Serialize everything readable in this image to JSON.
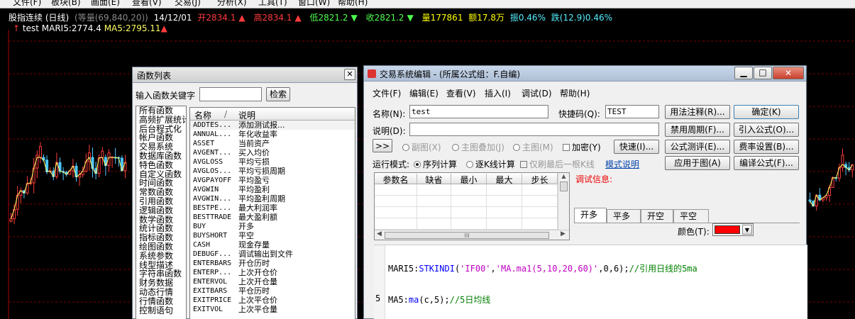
{
  "menubar": [
    "文件(F)",
    "板块(B)",
    "画面(E)",
    "查看(V)",
    "交易(J)",
    "分析(X)",
    "工具(T)",
    "窗口(W)",
    "帮助(H)"
  ],
  "chart": {
    "title": "股指连续 (日线)",
    "mode": "(等量(69,840,20))",
    "date": "14/12/01",
    "open": "开2834.1",
    "high": "高2834.1",
    "low": "低2821.2",
    "close": "收2821.2",
    "volume": "量177861",
    "amount": "额17.8万",
    "amplitude": "振0.46%",
    "change": "跌(12.9)0.46%",
    "indicator_name": "test",
    "mari5": "MARI5:2774.4",
    "ma5": "MA5:2795.11",
    "colors": {
      "up": "#ff3b3b",
      "down": "#4dc8ff",
      "ma": "#ffff66",
      "grid": "#7a0000"
    }
  },
  "function_list": {
    "title": "函数列表",
    "keyword_label": "输入函数关键字",
    "keyword_value": "",
    "search_button": "检索",
    "categories": [
      "所有函数",
      "高频扩展统计",
      "后台程式化",
      "帐户函数",
      "交易系统",
      "数据库函数",
      "特色函数",
      "自定义函数",
      "时间函数",
      "常数函数",
      "引用函数",
      "逻辑函数",
      "数学函数",
      "统计函数",
      "指标函数",
      "绘图函数",
      "系统参数",
      "线型描述",
      "字符串函数",
      "财务数据",
      "动态行情",
      "行情函数",
      "控制语句"
    ],
    "col_name": "名称",
    "col_desc": "说明",
    "rows": [
      {
        "name": "ADDTES...",
        "desc": "添加测试报..."
      },
      {
        "name": "ANNUAL...",
        "desc": "年化收益率"
      },
      {
        "name": "ASSET",
        "desc": "当前资产"
      },
      {
        "name": "AVGENT...",
        "desc": "买入均价"
      },
      {
        "name": "AVGLOSS",
        "desc": "平均亏损"
      },
      {
        "name": "AVGLOS...",
        "desc": "平均亏损周期"
      },
      {
        "name": "AVGPAYOFF",
        "desc": "平均盈亏"
      },
      {
        "name": "AVGWIN",
        "desc": "平均盈利"
      },
      {
        "name": "AVGWIN...",
        "desc": "平均盈利周期"
      },
      {
        "name": "BESTPE...",
        "desc": "最大利润率"
      },
      {
        "name": "BESTTRADE",
        "desc": "最大盈利额"
      },
      {
        "name": "BUY",
        "desc": "开多"
      },
      {
        "name": "BUYSHORT",
        "desc": "平空"
      },
      {
        "name": "CASH",
        "desc": "现金存量"
      },
      {
        "name": "DEBUGF...",
        "desc": "调试输出到文件"
      },
      {
        "name": "ENTERBARS",
        "desc": "开仓历时"
      },
      {
        "name": "ENTERP...",
        "desc": "上次开仓价"
      },
      {
        "name": "ENTERVOL",
        "desc": "上次开仓量"
      },
      {
        "name": "EXITBARS",
        "desc": "平仓历时"
      },
      {
        "name": "EXITPRICE",
        "desc": "上次平仓价"
      },
      {
        "name": "EXITVOL",
        "desc": "上次平仓量"
      }
    ]
  },
  "editor": {
    "title": "交易系统编辑 - (所属公式组：F.自编)",
    "menu": [
      "文件(F)",
      "编辑(E)",
      "查看(V)",
      "插入(I)",
      "调试(D)",
      "帮助(H)"
    ],
    "name_label": "名称(N):",
    "name_value": "test",
    "shortcut_label": "快捷码(Q):",
    "shortcut_value": "TEST",
    "desc_label": "说明(D):",
    "desc_value": "",
    "btn_usage": "用法注释(R)...",
    "btn_ok": "确定(K)",
    "btn_cycle": "禁用周期(F)...",
    "btn_import": "引入公式(O)...",
    "btn_evaluate": "公式测评(E)...",
    "btn_fee": "费率设置(B)...",
    "btn_apply": "应用于图(A)",
    "btn_compile": "编译公式(F)...",
    "arrows": ">>",
    "opt_sub": "副图(X)",
    "opt_main_overlay": "主图叠加(J)",
    "opt_main": "主图(M)",
    "opt_encrypt": "加密(Y)",
    "btn_hotkey": "快速(I)...",
    "run_mode_label": "运行模式:",
    "run_seq": "序列计算",
    "run_tick": "逐K线计算",
    "run_last_only": "仅刷最后一根K线",
    "mode_help_link": "模式说明",
    "param_headers": [
      "参数名",
      "缺省",
      "最小",
      "最大",
      "步长"
    ],
    "debug_label": "调试信息:",
    "tabs": [
      "开多",
      "平多",
      "开空",
      "平空"
    ],
    "color_label": "颜色(T):",
    "color_value": "#ff0000",
    "scroll_mark": "III",
    "code_lines": [
      {
        "num": "",
        "text": "MARI5:STKINDI('IF00','MA.ma1(5,10,20,60)',0,6);//引用日线的5ma"
      },
      {
        "num": "5",
        "text": "MA5:ma(c,5);//5日均线"
      }
    ]
  }
}
